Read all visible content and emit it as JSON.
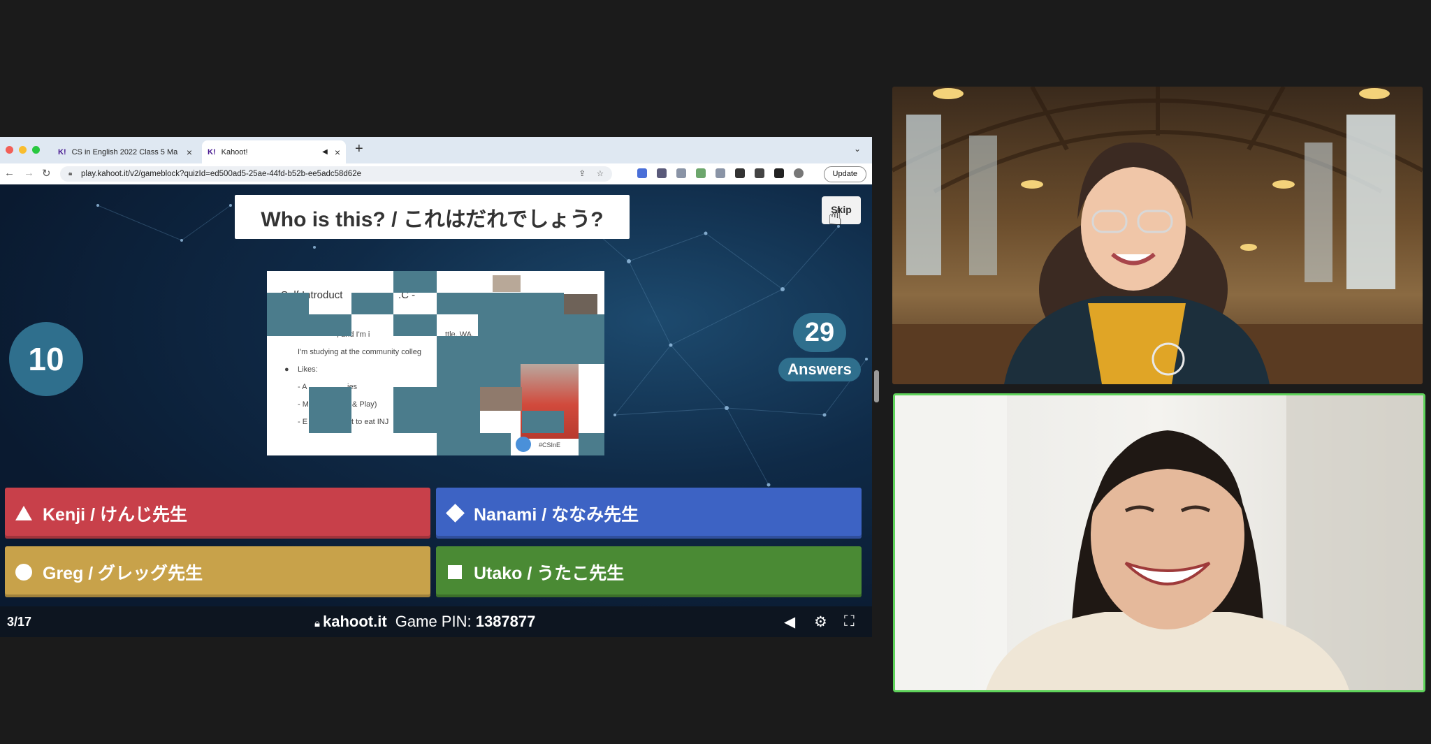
{
  "browser": {
    "tabs": [
      {
        "label": "CS in English 2022 Class 5 Ma",
        "favicon": "K!"
      },
      {
        "label": "Kahoot!",
        "favicon": "K!"
      }
    ],
    "url": "play.kahoot.it/v2/gameblock?quizId=ed500ad5-25ae-44fd-b52b-ee5adc58d62e",
    "update_label": "Update"
  },
  "game": {
    "question": "Who is this? / これはだれでしょう?",
    "skip_label": "Skip",
    "timer": "10",
    "answers_count": "29",
    "answers_label": "Answers",
    "slide": {
      "title_fragment": "Self Introduct",
      "title_end": ".C -",
      "line_city": ", and I'm i",
      "line_city_end": "ttle, WA.",
      "line_study": "I'm studying at the community colleg",
      "likes": "Likes:",
      "like1a": "- A",
      "like1b": "ies",
      "like2a": "- M",
      "like2b": "& Play)",
      "like3a": "- E",
      "like3b": "t to eat INJ",
      "hashtag": "#CSInE"
    },
    "choices": [
      {
        "label": "Kenji / けんじ先生",
        "shape": "triangle",
        "color": "#c8404a"
      },
      {
        "label": "Nanami / ななみ先生",
        "shape": "diamond",
        "color": "#3d63c4"
      },
      {
        "label": "Greg / グレッグ先生",
        "shape": "circle",
        "color": "#c8a24a"
      },
      {
        "label": "Utako / うたこ先生",
        "shape": "square",
        "color": "#4a8a34"
      }
    ],
    "progress": "3/17",
    "site": "kahoot.it",
    "pin_label": "Game PIN:",
    "pin": "1387877"
  },
  "participants": [
    {
      "name": "participant-top",
      "speaking": false
    },
    {
      "name": "participant-bottom",
      "speaking": true
    }
  ]
}
